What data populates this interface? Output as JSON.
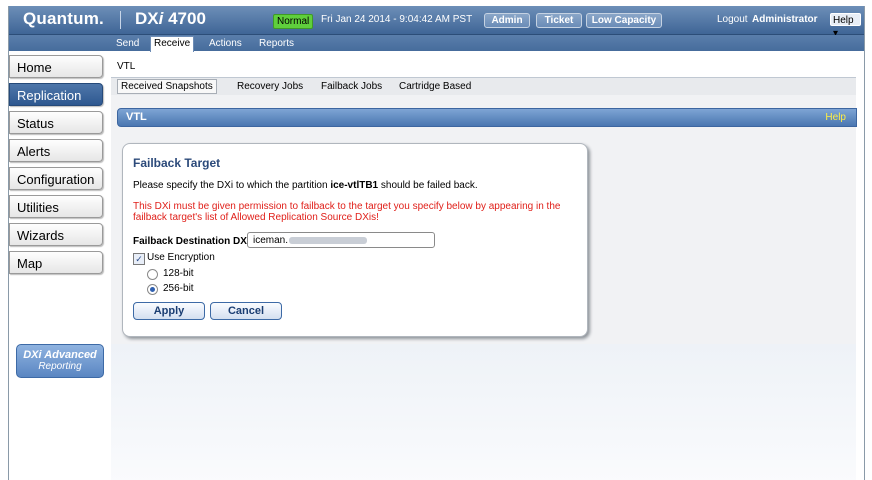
{
  "header": {
    "brand": "Quantum.",
    "product_prefix": "DX",
    "product_i": "i",
    "product_model": "4700",
    "status_badge": "Normal",
    "datetime": "Fri Jan 24 2014 - 9:04:42 AM PST",
    "pills": [
      "Admin",
      "Ticket",
      "Low Capacity"
    ],
    "logout": "Logout",
    "user": "Administrator",
    "help_menu": "Help ▾"
  },
  "top_tabs": [
    "Send",
    "Receive",
    "Actions",
    "Reports"
  ],
  "active_top_tab": "Receive",
  "breadcrumb": "VTL",
  "sidebar": {
    "items": [
      "Home",
      "Replication",
      "Status",
      "Alerts",
      "Configuration",
      "Utilities",
      "Wizards",
      "Map"
    ],
    "active": "Replication",
    "adv_badge_line1": "DXi Advanced",
    "adv_badge_line2": "Reporting"
  },
  "sub_tabs": [
    "Received Snapshots",
    "Recovery Jobs",
    "Failback Jobs",
    "Cartridge Based"
  ],
  "active_sub_tab": "Received Snapshots",
  "section": {
    "title": "VTL",
    "help": "Help"
  },
  "panel": {
    "title": "Failback Target",
    "instr_prefix": "Please specify the DXi to which the partition ",
    "partition_name": "ice-vtlTB1",
    "instr_suffix": " should be failed back.",
    "warning": "This DXi must be given permission to failback to the target you specify below by appearing in the failback target's list of Allowed Replication Source DXis!",
    "dest_label": "Failback Destination DXi",
    "dest_value": "iceman.",
    "encryption_label": "Use Encryption",
    "encryption_checked": true,
    "encryption_options": [
      "128-bit",
      "256-bit"
    ],
    "selected_option": "256-bit",
    "apply": "Apply",
    "cancel": "Cancel"
  },
  "colors": {
    "accent": "#3f6596",
    "status_ok": "#5fcf3c",
    "warning_text": "#e0201a",
    "help_text": "#ffee44"
  }
}
